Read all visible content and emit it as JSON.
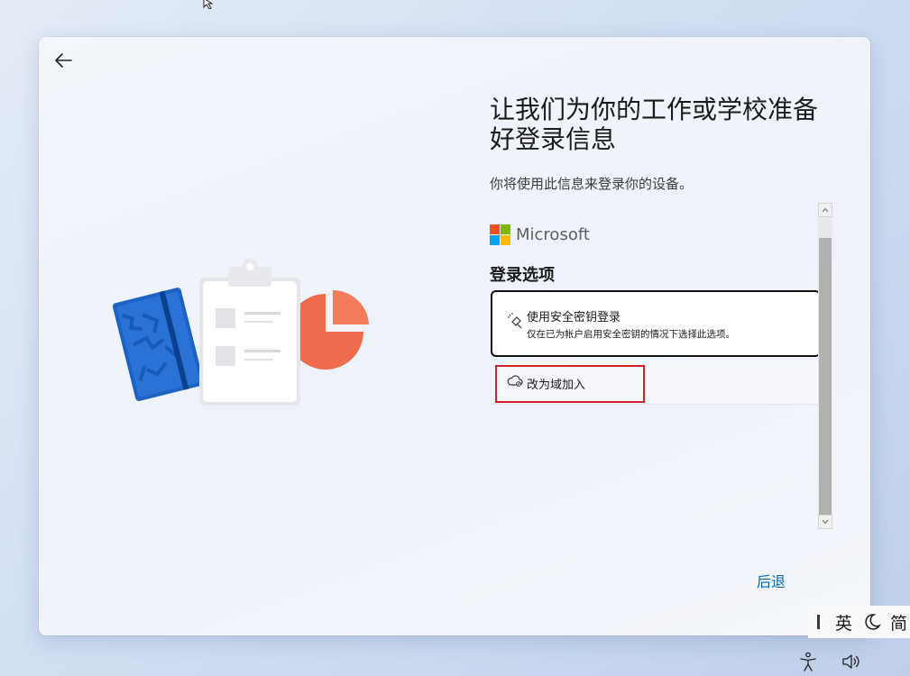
{
  "header": {
    "title": "让我们为你的工作或学校准备好登录信息",
    "subtitle": "你将使用此信息来登录你的设备。"
  },
  "brand": {
    "name": "Microsoft",
    "colors": [
      "#f25022",
      "#7fba00",
      "#00a4ef",
      "#ffb900"
    ]
  },
  "signin": {
    "section_title": "登录选项",
    "options": [
      {
        "icon": "security-key-icon",
        "title": "使用安全密钥登录",
        "description": "仅在已为帐户启用安全密钥的情况下选择此选项。"
      }
    ],
    "domain_join": {
      "icon": "cloud-icon",
      "label": "改为域加入"
    }
  },
  "footer": {
    "next_label": "后退"
  },
  "ime": {
    "language": "英",
    "mode": "简"
  },
  "colors": {
    "accent": "#0067c0",
    "highlight": "#d1232b"
  }
}
